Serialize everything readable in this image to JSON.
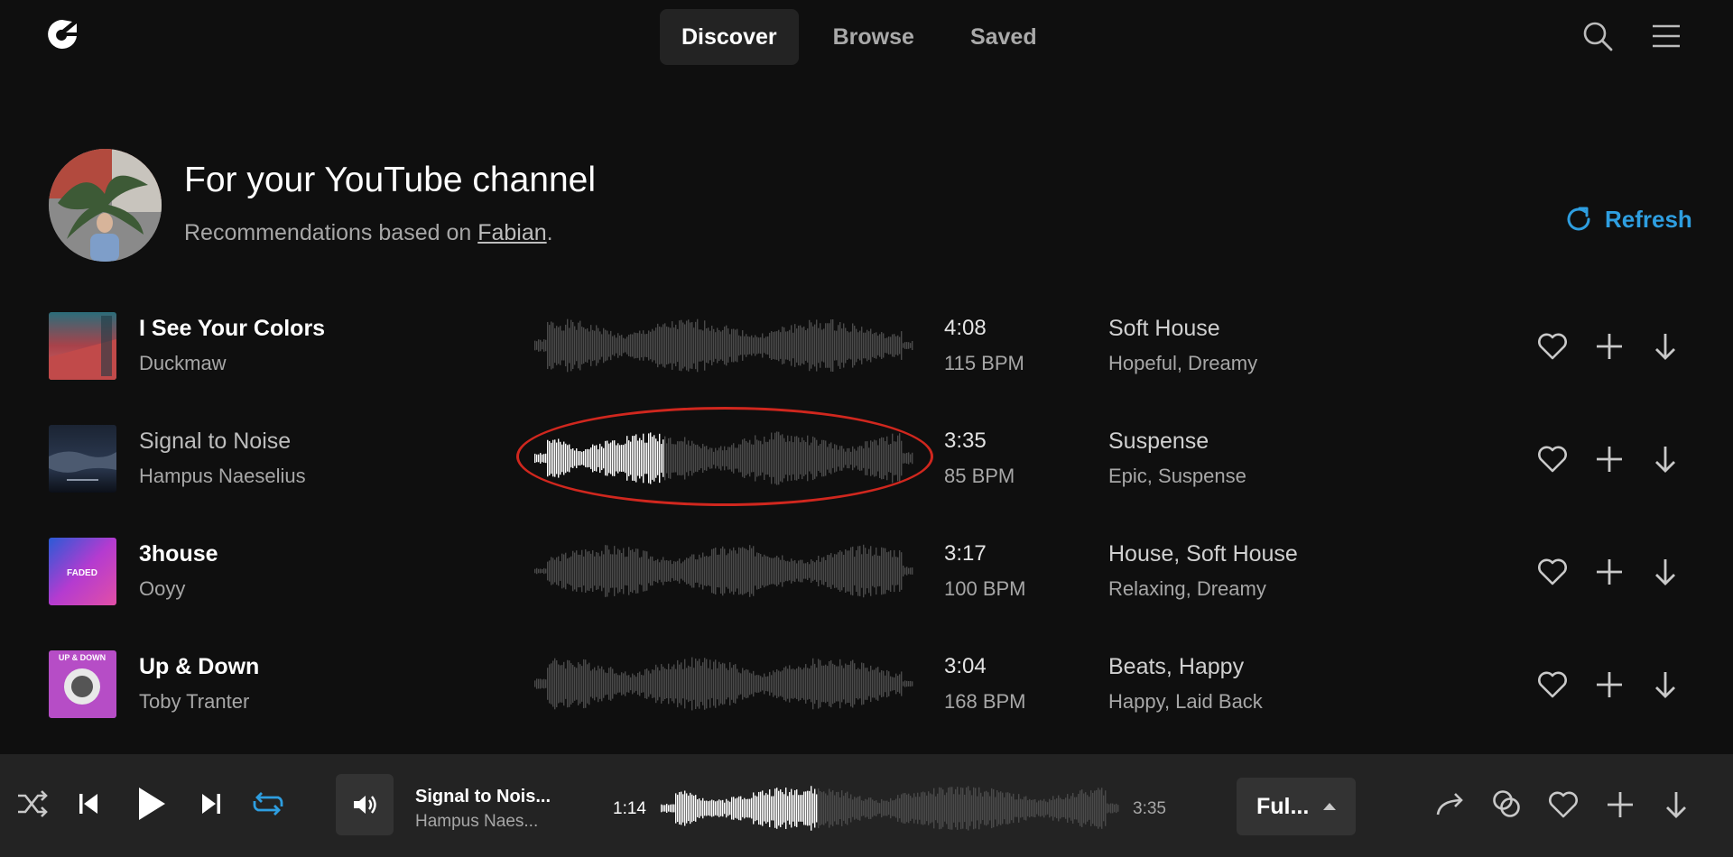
{
  "nav": {
    "tabs": [
      {
        "label": "Discover",
        "active": true
      },
      {
        "label": "Browse",
        "active": false
      },
      {
        "label": "Saved",
        "active": false
      }
    ],
    "icons": [
      "logo-icon",
      "search-icon",
      "menu-icon"
    ]
  },
  "header": {
    "title": "For your YouTube channel",
    "subtitle_prefix": "Recommendations based on ",
    "subtitle_link": "Fabian",
    "subtitle_suffix": ".",
    "refresh_label": "Refresh"
  },
  "tracks": [
    {
      "title": "I See Your Colors",
      "artist": "Duckmaw",
      "duration": "4:08",
      "bpm": "115 BPM",
      "genre": "Soft House",
      "mood": "Hopeful, Dreamy",
      "playing": false
    },
    {
      "title": "Signal to Noise",
      "artist": "Hampus Naeselius",
      "duration": "3:35",
      "bpm": "85 BPM",
      "genre": "Suspense",
      "mood": "Epic, Suspense",
      "playing": true
    },
    {
      "title": "3house",
      "artist": "Ooyy",
      "duration": "3:17",
      "bpm": "100 BPM",
      "genre": "House, Soft House",
      "mood": "Relaxing, Dreamy",
      "playing": false
    },
    {
      "title": "Up & Down",
      "artist": "Toby Tranter",
      "duration": "3:04",
      "bpm": "168 BPM",
      "genre": "Beats, Happy",
      "mood": "Happy, Laid Back",
      "playing": false
    }
  ],
  "cover_text": {
    "track3": "FADED",
    "track4": "UP & DOWN"
  },
  "player": {
    "now_title": "Signal to Nois...",
    "now_artist": "Hampus Naes...",
    "current_time": "1:14",
    "total_time": "3:35",
    "progress": 0.34,
    "version_label": "Ful..."
  },
  "colors": {
    "background": "#0f0f0f",
    "player_bg": "#232323",
    "accent": "#2e9ee0",
    "highlight_ring": "#d0271e"
  }
}
